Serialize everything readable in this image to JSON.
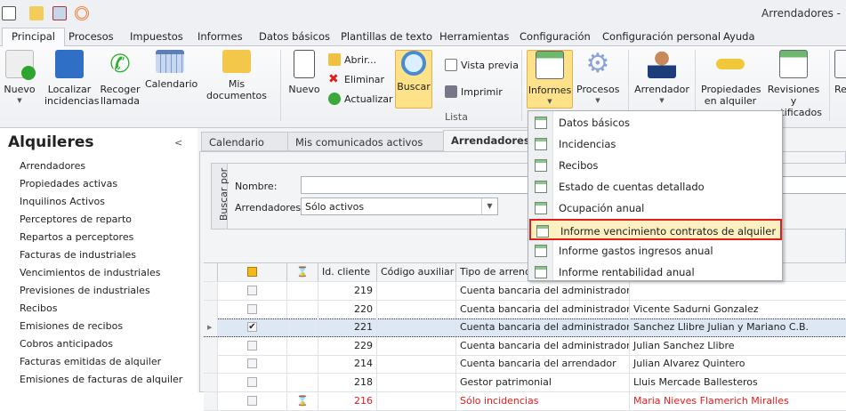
{
  "window": {
    "title": "Arrendadores -"
  },
  "quick_access": [
    "app-icon",
    "mail-icon",
    "clipboard-icon",
    "broadcast-icon"
  ],
  "ribbon_tabs": [
    "Principal",
    "Procesos",
    "Impuestos",
    "Informes",
    "Datos básicos",
    "Plantillas de texto",
    "Herramientas",
    "Configuración",
    "Configuración personal",
    "Ayuda"
  ],
  "ribbon": {
    "nuevo1": "Nuevo",
    "localizar": "Localizar incidencias",
    "recoger": "Recoger llamada",
    "calendario": "Calendario",
    "documentos": "Mis documentos",
    "nuevo2": "Nuevo",
    "abrir": "Abrir...",
    "eliminar": "Eliminar",
    "actualizar": "Actualizar",
    "buscar": "Buscar",
    "vista_previa": "Vista previa",
    "imprimir": "Imprimir",
    "group_lista": "Lista",
    "informes": "Informes",
    "procesos": "Procesos",
    "arrendador": "Arrendador",
    "propiedades": "Propiedades en alquiler",
    "revisiones": "Revisiones y certificados",
    "re": "Re"
  },
  "sidebar": {
    "title": "Alquileres",
    "items": [
      "Arrendadores",
      "Propiedades activas",
      "Inquilinos Activos",
      "Perceptores de reparto",
      "Repartos a perceptores",
      "Facturas de industriales",
      "Vencimientos de industriales",
      "Previsiones de industriales",
      "Recibos",
      "Emisiones de recibos",
      "Cobros anticipados",
      "Facturas emitidas de alquiler",
      "Emisiones de facturas de alquiler"
    ]
  },
  "doc_tabs": [
    "Calendario",
    "Mis comunicados activos",
    "Arrendadores"
  ],
  "search": {
    "group": "Buscar por",
    "nombre_label": "Nombre:",
    "nombre_value": "",
    "arrendadores_label": "Arrendadores:",
    "arrendadores_value": "Sólo activos"
  },
  "grid": {
    "headers": [
      "",
      "",
      "Id. cliente",
      "Código auxiliar",
      "Tipo de arrendador",
      ""
    ],
    "rows": [
      {
        "checked": false,
        "hourglass": false,
        "id": "219",
        "codigo": "",
        "tipo": "Cuenta bancaria del administrador",
        "nombre": "",
        "red": false,
        "selected": false
      },
      {
        "checked": false,
        "hourglass": false,
        "id": "220",
        "codigo": "",
        "tipo": "Cuenta bancaria del administrador",
        "nombre": "Vicente Sadurni Gonzalez",
        "red": false,
        "selected": false
      },
      {
        "checked": true,
        "hourglass": false,
        "id": "221",
        "codigo": "",
        "tipo": "Cuenta bancaria del administrador",
        "nombre": "Sanchez Llibre Julian y Mariano C.B.",
        "red": false,
        "selected": true
      },
      {
        "checked": false,
        "hourglass": false,
        "id": "229",
        "codigo": "",
        "tipo": "Cuenta bancaria del administrador",
        "nombre": "Julian Sanchez Llibre",
        "red": false,
        "selected": false
      },
      {
        "checked": false,
        "hourglass": false,
        "id": "214",
        "codigo": "",
        "tipo": "Cuenta bancaria del arrendador",
        "nombre": "Julian Alvarez Quintero",
        "red": false,
        "selected": false
      },
      {
        "checked": false,
        "hourglass": false,
        "id": "218",
        "codigo": "",
        "tipo": "Gestor patrimonial",
        "nombre": "Lluis Mercade Ballesteros",
        "red": false,
        "selected": false
      },
      {
        "checked": false,
        "hourglass": true,
        "id": "216",
        "codigo": "",
        "tipo": "Sólo incidencias",
        "nombre": "Maria Nieves Flamerich Miralles",
        "red": true,
        "selected": false
      }
    ]
  },
  "informes_menu": [
    "Datos básicos",
    "Incidencias",
    "Recibos",
    "Estado de cuentas detallado",
    "Ocupación anual",
    "Informe vencimiento contratos de alquiler",
    "Informe gastos ingresos anual",
    "Informe rentabilidad anual"
  ],
  "informes_highlighted": 5
}
